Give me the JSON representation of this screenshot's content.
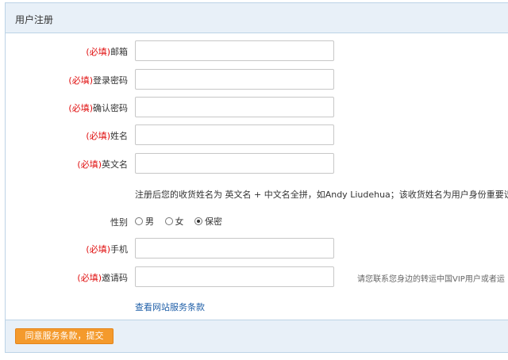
{
  "panel": {
    "title": "用户注册"
  },
  "required_marker": "(必填)",
  "fields": {
    "email": {
      "label": "邮箱",
      "value": ""
    },
    "password": {
      "label": "登录密码",
      "value": ""
    },
    "confirm_password": {
      "label": "确认密码",
      "value": ""
    },
    "name": {
      "label": "姓名",
      "value": ""
    },
    "english_name": {
      "label": "英文名",
      "value": ""
    },
    "phone": {
      "label": "手机",
      "value": ""
    },
    "invite_code": {
      "label": "邀请码",
      "value": ""
    }
  },
  "name_hint": "注册后您的收货姓名为 英文名 + 中文名全拼，如Andy Liudehua；该收货姓名为用户身份重要识别特",
  "gender": {
    "label": "性别",
    "options": [
      "男",
      "女",
      "保密"
    ],
    "selected": "保密"
  },
  "invite_hint": "请您联系您身边的转运中国VIP用户或者运",
  "terms_link": "查看网站服务条款",
  "submit_label": "同意服务条款，提交"
}
